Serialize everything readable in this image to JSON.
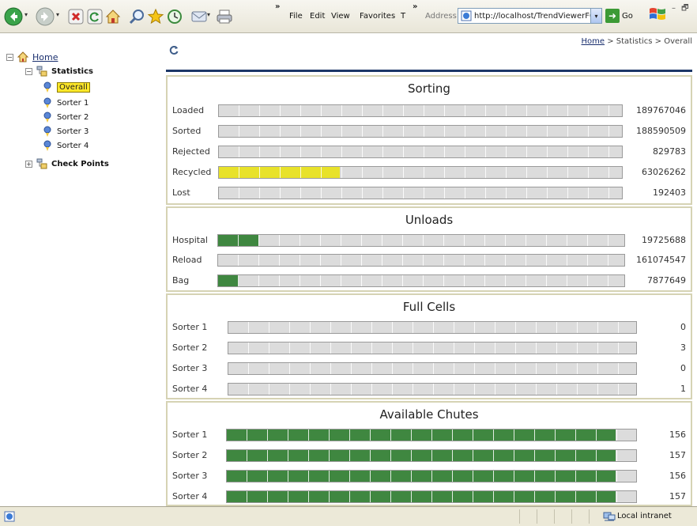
{
  "toolbar": {
    "menu": [
      "File",
      "Edit",
      "View",
      "Favorites",
      "T"
    ],
    "address_label": "Address",
    "address_url": "http://localhost/TrendViewerFGI/sta",
    "go_label": "Go"
  },
  "tree": {
    "home_label": "Home",
    "statistics_label": "Statistics",
    "overall_label": "Overall",
    "sorters": [
      "Sorter 1",
      "Sorter 2",
      "Sorter 3",
      "Sorter 4"
    ],
    "checkpoints_label": "Check Points"
  },
  "breadcrumb": {
    "home": "Home",
    "sep1": " > ",
    "statistics": "Statistics",
    "sep2": " > ",
    "overall": "Overall"
  },
  "panels": {
    "sorting": {
      "title": "Sorting",
      "rows": [
        {
          "label": "Loaded",
          "value": "189767046",
          "fill_percent": 0,
          "color": "#e8e22a"
        },
        {
          "label": "Sorted",
          "value": "188590509",
          "fill_percent": 0,
          "color": "#e8e22a"
        },
        {
          "label": "Rejected",
          "value": "829783",
          "fill_percent": 0,
          "color": "#e8e22a"
        },
        {
          "label": "Recycled",
          "value": "63026262",
          "fill_percent": 30,
          "color": "#e8e22a"
        },
        {
          "label": "Lost",
          "value": "192403",
          "fill_percent": 0,
          "color": "#e8e22a"
        }
      ]
    },
    "unloads": {
      "title": "Unloads",
      "rows": [
        {
          "label": "Hospital",
          "value": "19725688",
          "fill_percent": 10,
          "color": "#3f8740"
        },
        {
          "label": "Reload",
          "value": "161074547",
          "fill_percent": 0,
          "color": "#3f8740"
        },
        {
          "label": "Bag",
          "value": "7877649",
          "fill_percent": 5,
          "color": "#3f8740"
        }
      ]
    },
    "full_cells": {
      "title": "Full Cells",
      "rows": [
        {
          "label": "Sorter 1",
          "value": "0",
          "fill_percent": 0,
          "color": "#3f8740"
        },
        {
          "label": "Sorter 2",
          "value": "3",
          "fill_percent": 0,
          "color": "#3f8740"
        },
        {
          "label": "Sorter 3",
          "value": "0",
          "fill_percent": 0,
          "color": "#3f8740"
        },
        {
          "label": "Sorter 4",
          "value": "1",
          "fill_percent": 0,
          "color": "#3f8740"
        }
      ]
    },
    "available_chutes": {
      "title": "Available Chutes",
      "rows": [
        {
          "label": "Sorter 1",
          "value": "156",
          "fill_percent": 95,
          "color": "#3f8740"
        },
        {
          "label": "Sorter 2",
          "value": "157",
          "fill_percent": 95,
          "color": "#3f8740"
        },
        {
          "label": "Sorter 3",
          "value": "156",
          "fill_percent": 95,
          "color": "#3f8740"
        },
        {
          "label": "Sorter 4",
          "value": "157",
          "fill_percent": 95,
          "color": "#3f8740"
        }
      ]
    }
  },
  "statusbar": {
    "zone": "Local intranet"
  },
  "icons": [
    "back-icon",
    "forward-icon",
    "stop-icon",
    "refresh-icon",
    "home-icon",
    "search-icon",
    "favorites-star-icon",
    "history-icon",
    "mail-icon",
    "print-icon",
    "page-icon",
    "go-arrow-icon",
    "windows-logo-icon",
    "folder-icon",
    "pin-icon",
    "intranet-icon"
  ]
}
